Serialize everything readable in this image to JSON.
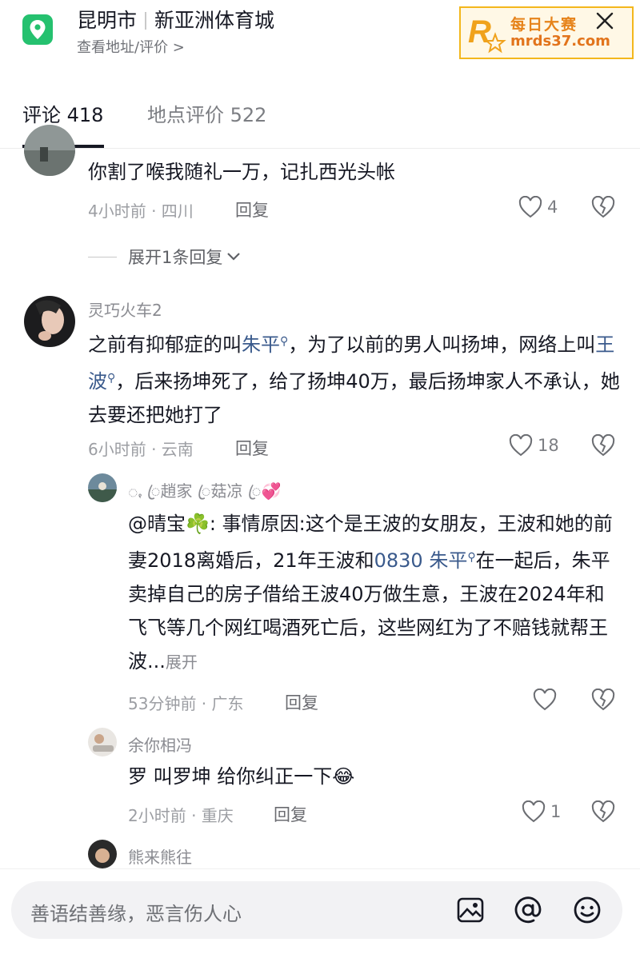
{
  "header": {
    "city": "昆明市",
    "place": "新亚洲体育城",
    "address_link": "查看地址/评价 >"
  },
  "watermark": {
    "title": "每日大赛",
    "url": "mrds37.com",
    "logo_letter": "R"
  },
  "tabs": [
    {
      "label": "评论 418",
      "active": true
    },
    {
      "label": "地点评价 522",
      "active": false
    }
  ],
  "comments": [
    {
      "text": "你割了喉我随礼一万，记扎西光头帐",
      "time": "4小时前 · 四川",
      "reply": "回复",
      "likes": "4",
      "expand_replies": "展开1条回复"
    },
    {
      "user": "灵巧火车2",
      "text_parts": [
        "之前有抑郁症的叫",
        "朱平",
        "，为了以前的男人叫扬坤，网络上叫",
        "王波",
        "，后来扬坤死了，给了扬坤40万，最后扬坤家人不承认，她去要还把她打了"
      ],
      "time": "6小时前 · 云南",
      "reply": "回复",
      "likes": "18",
      "replies": [
        {
          "user": "ꩻ ꦿ趙家 ꦿ菇凉 ꦿ",
          "text_parts": [
            "@晴宝",
            "☘️",
            ": 事情原因:这个是王波的女朋友，王波和她的前妻2018离婚后，21年王波和",
            "0830 朱平",
            "在一起后，朱平卖掉自己的房子借给王波40万做生意，王波在2024年和飞飞等几个网红喝酒死亡后，这些网红为了不赔钱就帮王波...",
            "展开"
          ],
          "time": "53分钟前 · 广东",
          "reply": "回复"
        },
        {
          "user": "余你相冯",
          "text": "罗 叫罗坤 给你纠正一下",
          "emoji": "😂",
          "time": "2小时前 · 重庆",
          "reply": "回复",
          "likes": "1"
        },
        {
          "user": "熊来熊往"
        }
      ]
    }
  ],
  "input": {
    "placeholder": "善语结善缘，恶言伤人心"
  },
  "colors": {
    "accent_green": "#25c16f",
    "link_blue": "#3a5a8c",
    "watermark_orange": "#e6831a"
  },
  "icons": [
    "location-pin-icon",
    "close-icon",
    "heart-icon",
    "broken-heart-icon",
    "chevron-down-icon",
    "image-icon",
    "at-icon",
    "emoji-icon",
    "magnifier-icon"
  ]
}
